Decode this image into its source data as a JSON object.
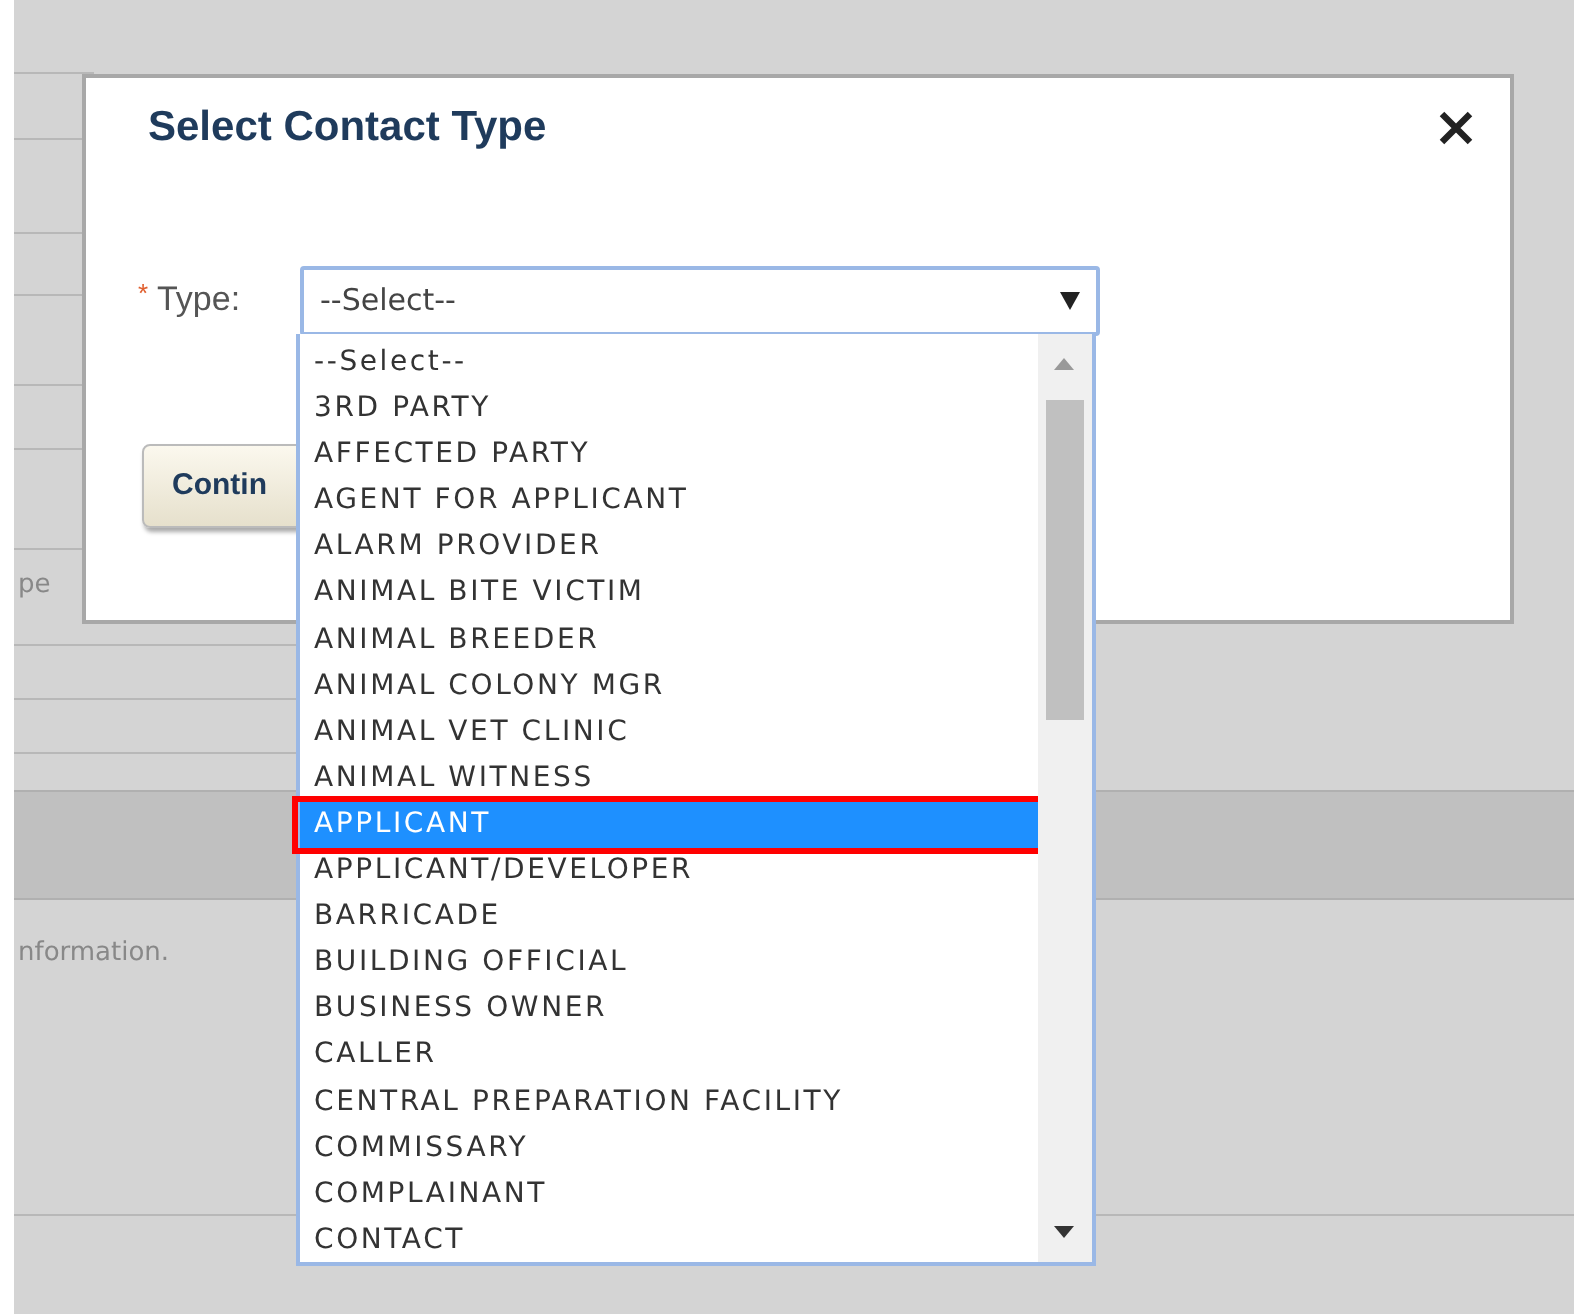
{
  "background": {
    "texts": [
      "pe",
      "nformation."
    ]
  },
  "dialog": {
    "title": "Select Contact Type",
    "required_mark": "*",
    "type_label": "Type:",
    "type_value": "--Select--",
    "continue_button": "Contin"
  },
  "options": [
    {
      "label": "--Select--",
      "selected": false
    },
    {
      "label": "3RD PARTY",
      "selected": false
    },
    {
      "label": "AFFECTED PARTY",
      "selected": false
    },
    {
      "label": "AGENT FOR APPLICANT",
      "selected": false
    },
    {
      "label": "ALARM PROVIDER",
      "selected": false
    },
    {
      "label": "ANIMAL BITE VICTIM",
      "selected": false
    },
    {
      "label": "ANIMAL BREEDER",
      "selected": false
    },
    {
      "label": "ANIMAL COLONY MGR",
      "selected": false
    },
    {
      "label": "ANIMAL VET CLINIC",
      "selected": false
    },
    {
      "label": "ANIMAL WITNESS",
      "selected": false
    },
    {
      "label": "APPLICANT",
      "selected": true
    },
    {
      "label": "APPLICANT/DEVELOPER",
      "selected": false
    },
    {
      "label": "BARRICADE",
      "selected": false
    },
    {
      "label": "BUILDING OFFICIAL",
      "selected": false
    },
    {
      "label": "BUSINESS OWNER",
      "selected": false
    },
    {
      "label": "CALLER",
      "selected": false
    },
    {
      "label": "CENTRAL PREPARATION FACILITY",
      "selected": false
    },
    {
      "label": "COMMISSARY",
      "selected": false
    },
    {
      "label": "COMPLAINANT",
      "selected": false
    },
    {
      "label": "CONTACT",
      "selected": false
    }
  ]
}
